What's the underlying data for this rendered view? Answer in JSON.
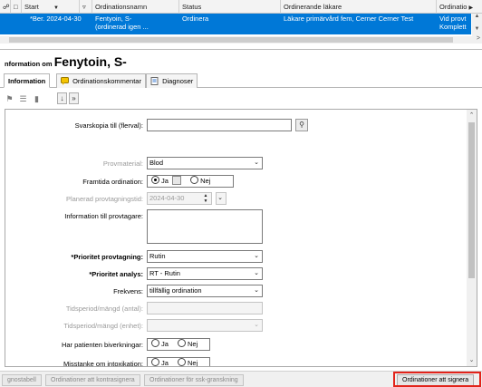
{
  "grid": {
    "columns": [
      "Start",
      "Ordinationsnamn",
      "Status",
      "Ordinerande läkare",
      "Ordinatio"
    ],
    "row": {
      "start": "*Ber. 2024-04-30",
      "name_line1": "Fentyoin, S-",
      "name_line2": "(ordinerad igen ...",
      "status": "Ordinera",
      "doctor": "Läkare primärvård fem, Cerner Cerner Test",
      "extra_line1": "Vid provt",
      "extra_line2": "Komplett"
    }
  },
  "section": {
    "prefix": "nformation om",
    "patient": "Fenytoin, S-"
  },
  "tabs": {
    "information": "Information",
    "comment": "Ordinationskommentar",
    "diagnoses": "Diagnoser"
  },
  "form": {
    "svarskopia_label": "Svarskopia till (flerval):",
    "svarskopia_value": "",
    "provmaterial_label": "Provmaterial:",
    "provmaterial_value": "Blod",
    "framtida_label": "Framtida ordination:",
    "framtida_ja": "Ja",
    "framtida_nej": "Nej",
    "planerad_label": "Planerad provtagningstid:",
    "planerad_value": "2024-04-30",
    "info_label": "Information till provtagare:",
    "info_value": "",
    "prio_provtagning_label": "*Prioritet provtagning:",
    "prio_provtagning_value": "Rutin",
    "prio_analys_label": "*Prioritet analys:",
    "prio_analys_value": "RT - Rutin",
    "frekvens_label": "Frekvens:",
    "frekvens_value": "tillfällig ordination",
    "tidsperiod_antal_label": "Tidsperiod/mängd (antal):",
    "tidsperiod_enhet_label": "Tidsperiod/mängd (enhet):",
    "biverkningar_label": "Har patienten biverkningar:",
    "biverkningar_ja": "Ja",
    "biverkningar_nej": "Nej",
    "misstanke_label": "Misstanke om intoxikation:",
    "misstanke_ja": "Ja",
    "misstanke_nej": "Nej"
  },
  "buttons": {
    "diagnostabell": "gnostabell",
    "kontrasignera": "Ordinationer att kontrasignera",
    "ssk_granskning": "Ordinationer för ssk-granskning",
    "signera": "Ordinationer att signera"
  },
  "colors": {
    "selection": "#0078d7",
    "highlight": "#e2231a"
  }
}
